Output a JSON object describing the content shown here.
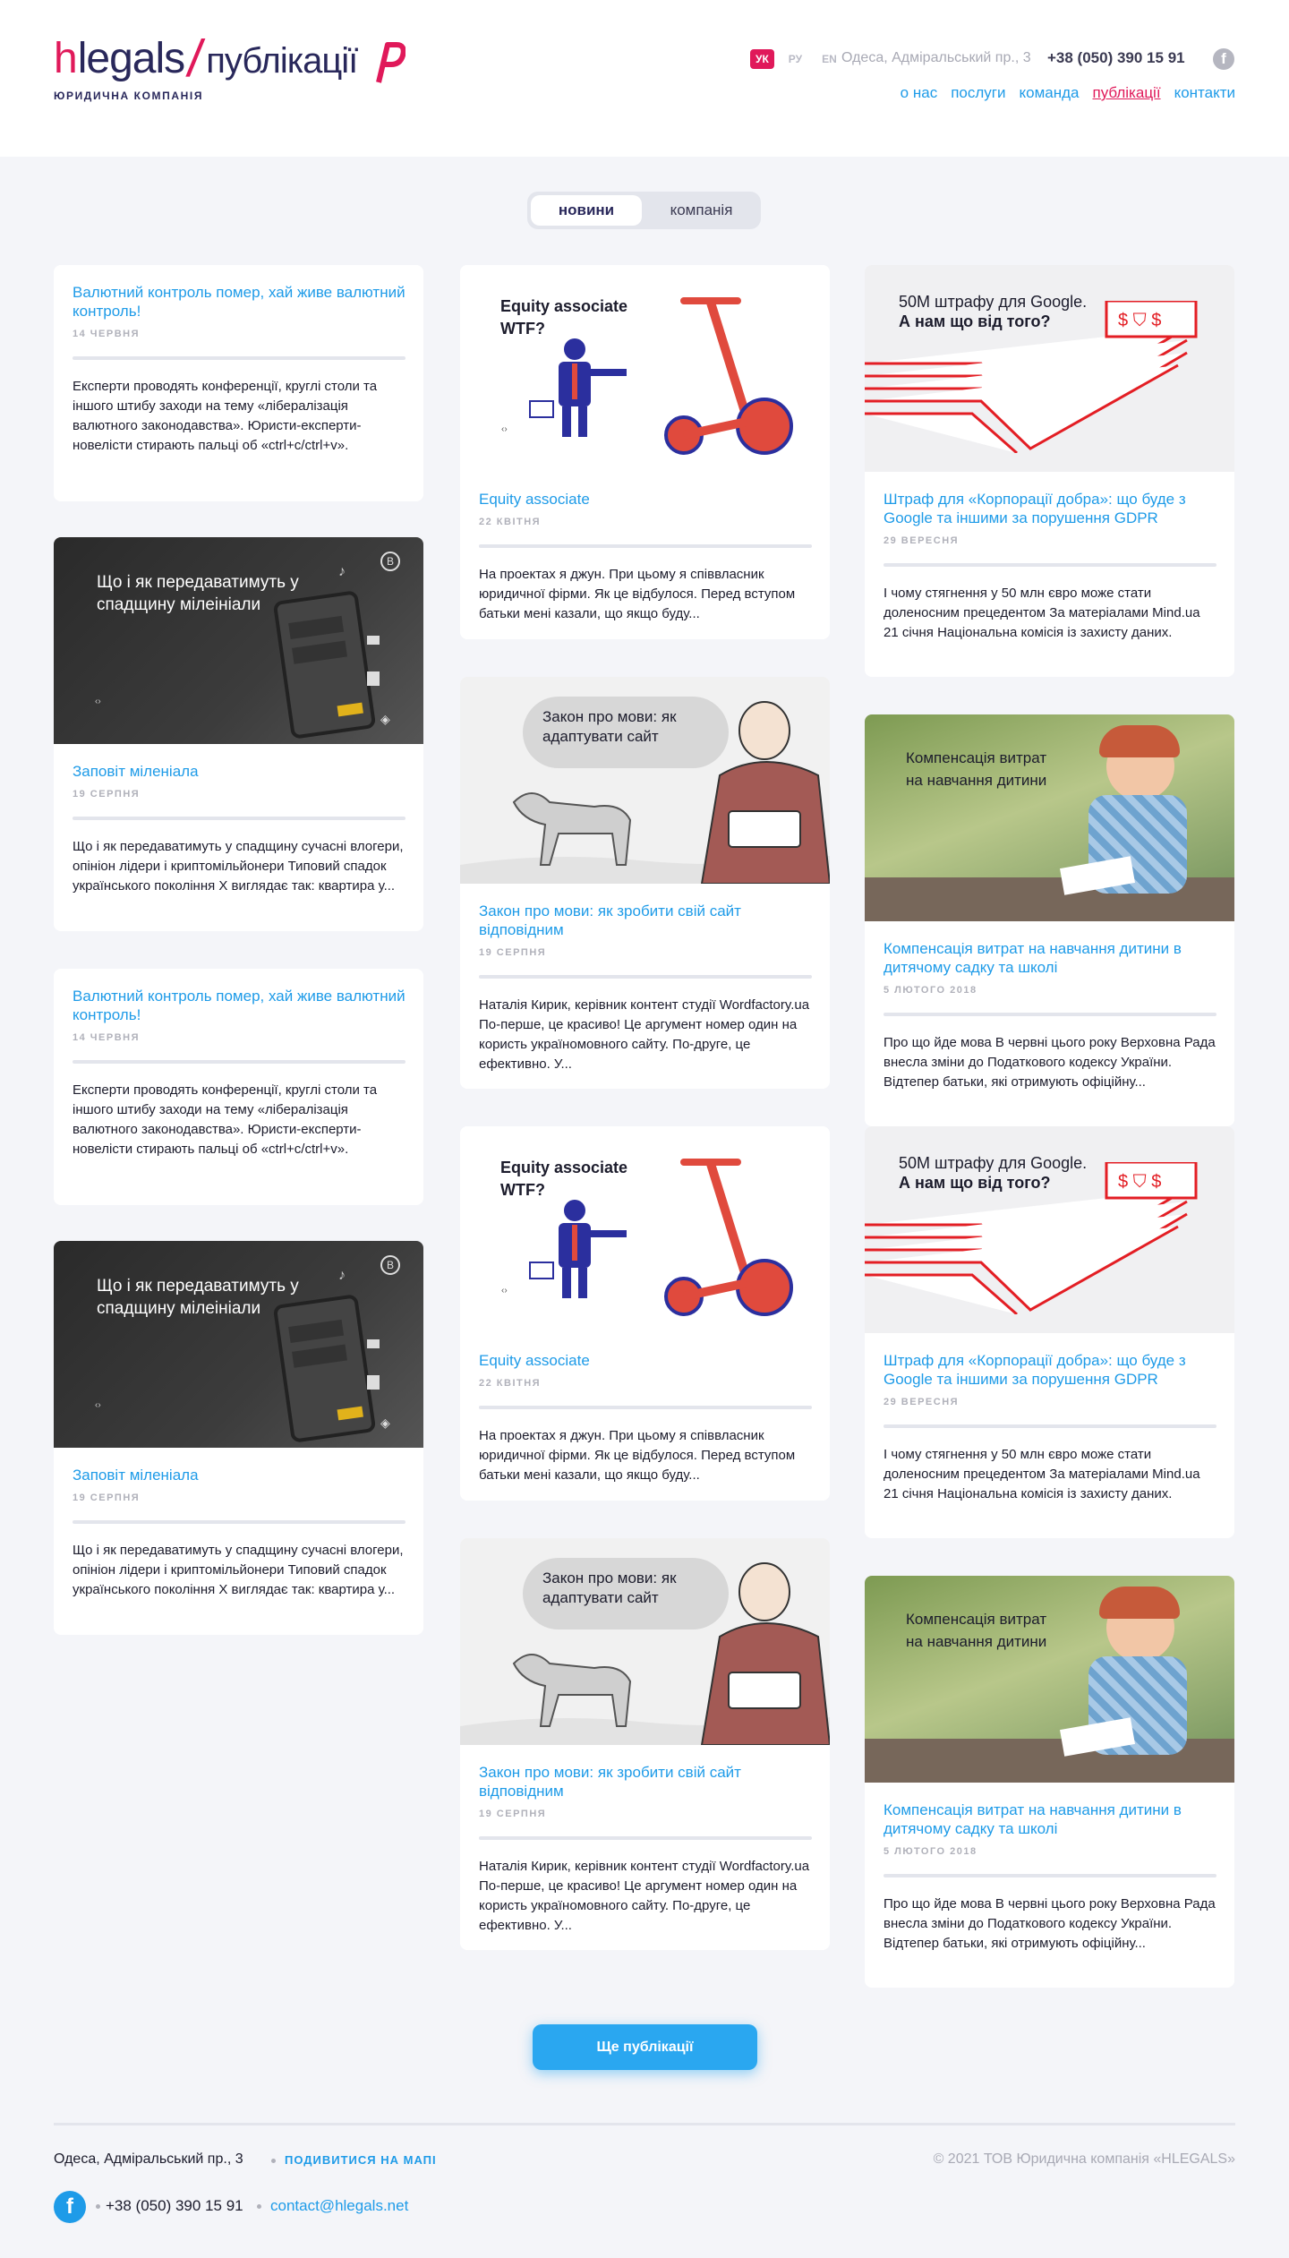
{
  "header": {
    "logo_h": "h",
    "logo_legals": "legals",
    "logo_slash": "/",
    "logo_pub": "публікації",
    "logo_sub": "ЮРИДИЧНА КОМПАНІЯ",
    "langs": [
      "УК",
      "РУ",
      "EN"
    ],
    "address": "Одеса, Адміральський пр., 3",
    "phone": "+38 (050) 390 15 91",
    "nav": [
      "о нас",
      "послуги",
      "команда",
      "публікації",
      "контакти"
    ]
  },
  "tabs": [
    "новини",
    "компанія"
  ],
  "images": {
    "equity": "Equity associate WTF?",
    "mova": "Закон про мови: як адаптувати сайт",
    "gdpr_line1": "50M штрафу для Google.",
    "gdpr_line2": "А нам що від того?",
    "millennial": "Що і як передаватимуть у спадщину мілеініали",
    "comp": "Компенсація витрат на навчання дитини"
  },
  "cards": {
    "c1": {
      "title": "Валютний контроль помер, хай живе валютний контроль!",
      "date": "14 ЧЕРВНЯ",
      "text": "Експерти проводять конференції, круглі столи та іншого штибу заходи на тему «лібералізація валютного законодавства». Юристи-експерти-новелісти стирають пальці об «ctrl+c/ctrl+v»."
    },
    "c2": {
      "title": "Заповіт міленіала",
      "date": "19 СЕРПНЯ",
      "text": "Що і як передаватимуть у спадщину сучасні влогери, опініон лідери і криптомільйонери Типовий спадок українського покоління X виглядає так: квартира у..."
    },
    "c3": {
      "title": "Валютний контроль помер, хай живе валютний контроль!",
      "date": "14 ЧЕРВНЯ",
      "text": "Експерти проводять конференції, круглі столи та іншого штибу заходи на тему «лібералізація валютного законодавства». Юристи-експерти-новелісти стирають пальці об «ctrl+c/ctrl+v»."
    },
    "c4": {
      "title": "Заповіт міленіала",
      "date": "19 СЕРПНЯ",
      "text": "Що і як передаватимуть у спадщину сучасні влогери, опініон лідери і криптомільйонери Типовий спадок українського покоління X виглядає так: квартира у..."
    },
    "c5": {
      "title": "Equity associate",
      "date": "22 КВІТНЯ",
      "text": "На проектах я джун. При цьому я співвласник юридичної фірми. Як це відбулося. Перед вступом батьки мені казали, що якщо буду..."
    },
    "c6": {
      "title": "Закон про мови: як зробити свій сайт відповідним",
      "date": "19 СЕРПНЯ",
      "text": "Наталія Кирик, керівник контент студії Wordfactory.ua По-перше, це красиво! Це аргумент номер один на користь україномовного сайту. По-друге, це ефективно. У..."
    },
    "c7": {
      "title": "Equity associate",
      "date": "22 КВІТНЯ",
      "text": "На проектах я джун. При цьому я співвласник юридичної фірми. Як це відбулося. Перед вступом батьки мені казали, що якщо буду..."
    },
    "c8": {
      "title": "Закон про мови: як зробити свій сайт відповідним",
      "date": "19 СЕРПНЯ",
      "text": "Наталія Кирик, керівник контент студії Wordfactory.ua По-перше, це красиво! Це аргумент номер один на користь україномовного сайту. По-друге, це ефективно. У..."
    },
    "c9": {
      "title": "Штраф для «Корпорації добра»: що буде з Google та іншими за порушення GDPR",
      "date": "29 ВЕРЕСНЯ",
      "text": "І чому стягнення у 50 млн євро може стати доленосним прецедентом За матеріалами Mind.ua 21 січня Національна комісія із захисту даних."
    },
    "c10": {
      "title": "Компенсація витрат на навчання дитини в дитячому садку та школі",
      "date": "5 ЛЮТОГО 2018",
      "text": "Про що йде мова В червні цього року Верховна Рада внесла зміни до Податкового кодексу України. Відтепер батьки, які отримують офіційну..."
    },
    "c11": {
      "title": "Штраф для «Корпорації добра»: що буде з Google та іншими за порушення GDPR",
      "date": "29 ВЕРЕСНЯ",
      "text": "І чому стягнення у 50 млн євро може стати доленосним прецедентом За матеріалами Mind.ua 21 січня Національна комісія із захисту даних."
    },
    "c12": {
      "title": "Компенсація витрат на навчання дитини в дитячому садку та школі",
      "date": "5 ЛЮТОГО 2018",
      "text": "Про що йде мова В червні цього року Верховна Рада внесла зміни до Податкового кодексу України. Відтепер батьки, які отримують офіційну..."
    }
  },
  "more_button": "Ще публікації",
  "footer": {
    "address": "Одеса, Адміральський пр., 3",
    "map_link": "ПОДИВИТИСЯ НА МАПІ",
    "copyright": "© 2021 ТОВ Юридична компанія «HLEGALS»",
    "phone": "+38 (050) 390 15 91",
    "email": "contact@hlegals.net"
  },
  "colors": {
    "accent": "#1e9be8",
    "brand": "#e0195a",
    "navy": "#29285b"
  }
}
